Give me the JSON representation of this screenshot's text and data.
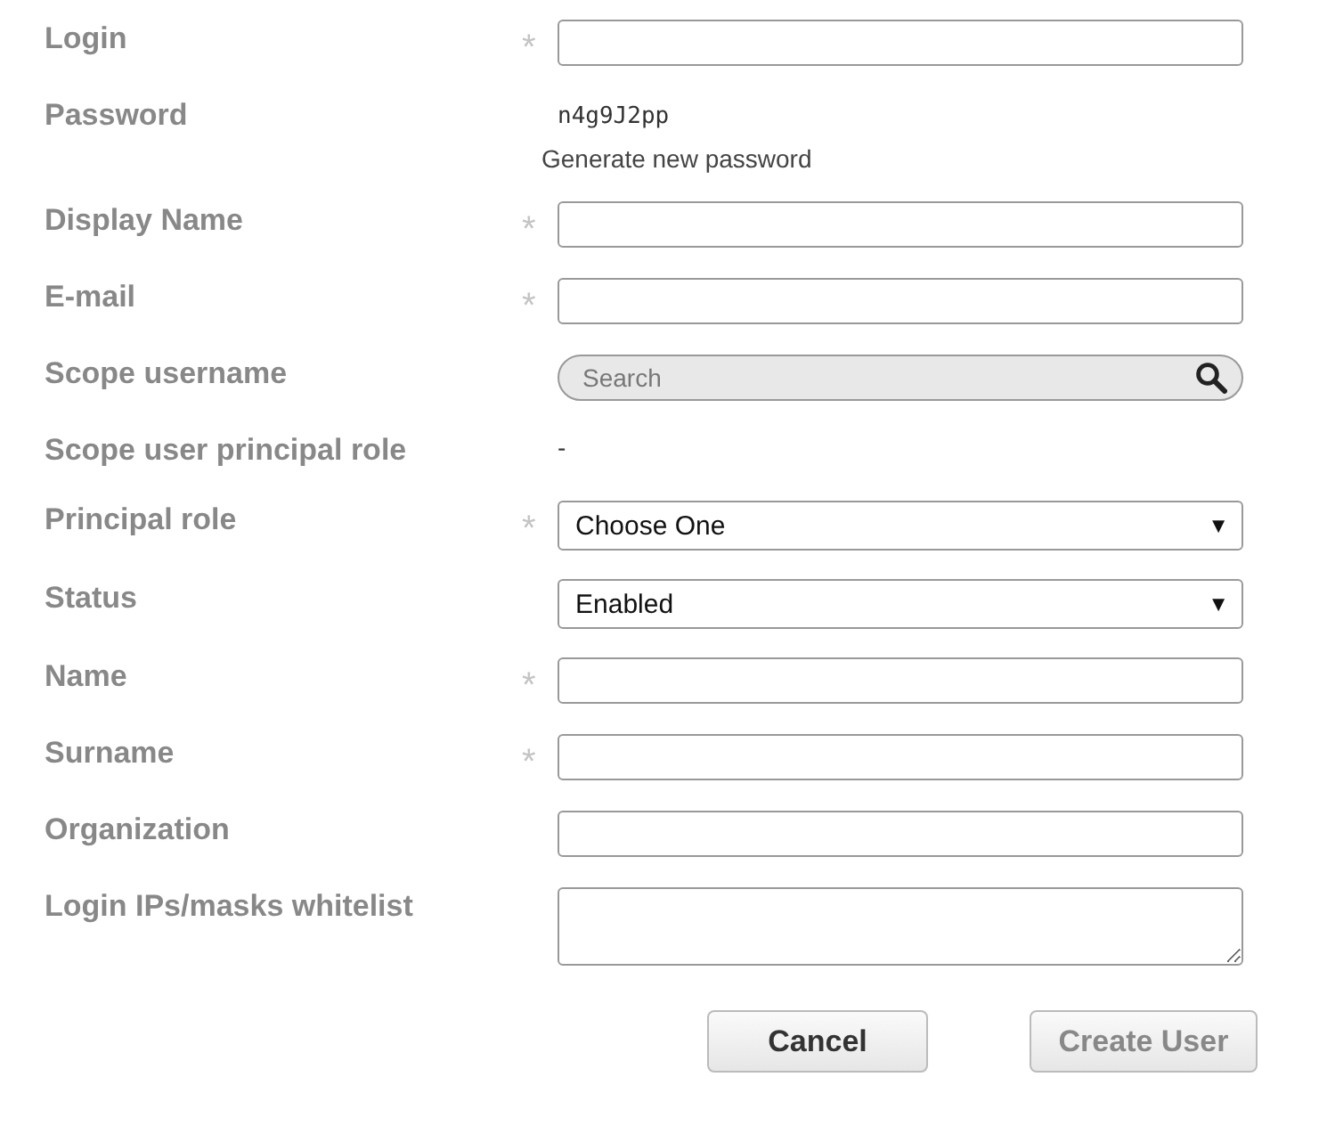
{
  "fields": [
    {
      "kind": "text",
      "label": "Login",
      "mark": "*"
    },
    {
      "kind": "password",
      "label": "Password",
      "value": "n4g9J2pp",
      "link": "Generate new password"
    },
    {
      "kind": "text",
      "label": "Display Name",
      "mark": "*"
    },
    {
      "kind": "text",
      "label": "E-mail",
      "mark": "*"
    },
    {
      "kind": "search",
      "label": "Scope username",
      "placeholder": "Search"
    },
    {
      "kind": "static",
      "label": "Scope user principal role",
      "value": "-"
    },
    {
      "kind": "select",
      "label": "Principal role",
      "mark": "*",
      "value": "Choose One",
      "caret": "▼"
    },
    {
      "kind": "select",
      "label": "Status",
      "value": "Enabled",
      "caret": "▼"
    },
    {
      "kind": "text",
      "label": "Name",
      "mark": "*"
    },
    {
      "kind": "text",
      "label": "Surname",
      "mark": "*"
    },
    {
      "kind": "text",
      "label": "Organization"
    },
    {
      "kind": "textarea",
      "label": "Login IPs/masks whitelist"
    }
  ],
  "buttons": [
    {
      "label": "Cancel",
      "disabled": false
    },
    {
      "label": "Create User",
      "disabled": true
    }
  ]
}
